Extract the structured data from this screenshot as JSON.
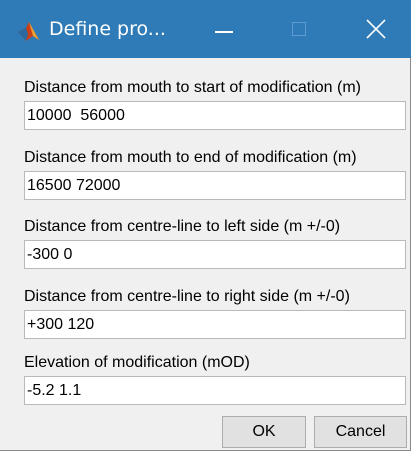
{
  "window": {
    "title": "Define pro...",
    "titlebar_color": "#2e7bb7",
    "icon": "matlab-icon",
    "controls": [
      "minimize-icon",
      "maximize-icon",
      "close-icon"
    ]
  },
  "fields": [
    {
      "label": "Distance from mouth to start of modification (m)",
      "value": "10000  56000"
    },
    {
      "label": "Distance from mouth to end of modification (m)",
      "value": "16500 72000"
    },
    {
      "label": "Distance from centre-line to left side (m +/-0)",
      "value": "-300 0"
    },
    {
      "label": "Distance from centre-line to right side (m +/-0)",
      "value": "+300 120"
    },
    {
      "label": "Elevation of modification (mOD)",
      "value": "-5.2 1.1"
    }
  ],
  "buttons": {
    "ok": "OK",
    "cancel": "Cancel"
  }
}
